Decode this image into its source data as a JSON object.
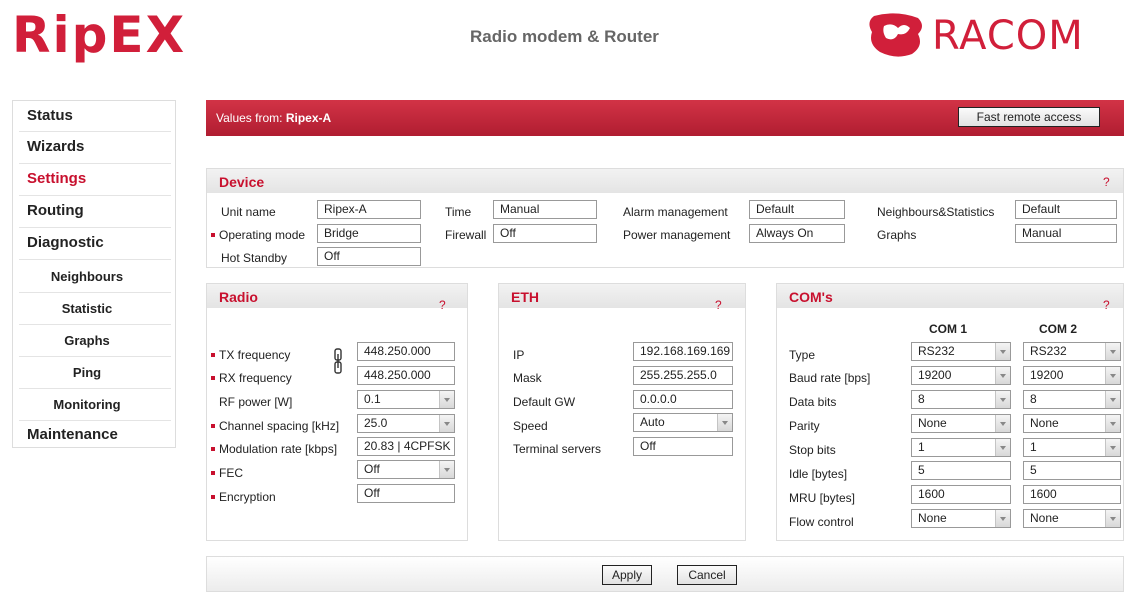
{
  "header": {
    "logo": "RipEX",
    "subtitle": "Radio modem & Router",
    "brand": "RACOM"
  },
  "nav": {
    "items": [
      "Status",
      "Wizards",
      "Settings",
      "Routing",
      "Diagnostic"
    ],
    "sub_items": [
      "Neighbours",
      "Statistic",
      "Graphs",
      "Ping",
      "Monitoring"
    ],
    "last": "Maintenance",
    "active": "Settings"
  },
  "topbar": {
    "label": "Values from:",
    "unit": "Ripex-A",
    "button": "Fast remote access"
  },
  "device": {
    "title": "Device",
    "help": "?",
    "unit_name_label": "Unit name",
    "unit_name": "Ripex-A",
    "operating_mode_label": "Operating mode",
    "operating_mode": "Bridge",
    "hot_standby_label": "Hot Standby",
    "hot_standby": "Off",
    "time_label": "Time",
    "time": "Manual",
    "firewall_label": "Firewall",
    "firewall": "Off",
    "alarm_label": "Alarm management",
    "alarm": "Default",
    "power_label": "Power management",
    "power": "Always On",
    "neighbours_label": "Neighbours&Statistics",
    "neighbours": "Default",
    "graphs_label": "Graphs",
    "graphs": "Manual"
  },
  "radio": {
    "title": "Radio",
    "help": "?",
    "tx_label": "TX frequency",
    "tx": "448.250.000",
    "rx_label": "RX frequency",
    "rx": "448.250.000",
    "rf_label": "RF power [W]",
    "rf": "0.1",
    "ch_label": "Channel spacing [kHz]",
    "ch": "25.0",
    "mod_label": "Modulation rate [kbps]",
    "mod": "20.83 | 4CPFSK",
    "fec_label": "FEC",
    "fec": "Off",
    "enc_label": "Encryption",
    "enc": "Off"
  },
  "eth": {
    "title": "ETH",
    "help": "?",
    "ip_label": "IP",
    "ip": "192.168.169.169",
    "mask_label": "Mask",
    "mask": "255.255.255.0",
    "gw_label": "Default GW",
    "gw": "0.0.0.0",
    "speed_label": "Speed",
    "speed": "Auto",
    "ts_label": "Terminal servers",
    "ts": "Off"
  },
  "coms": {
    "title": "COM's",
    "help": "?",
    "col1": "COM 1",
    "col2": "COM 2",
    "type_label": "Type",
    "type1": "RS232",
    "type2": "RS232",
    "baud_label": "Baud rate [bps]",
    "baud1": "19200",
    "baud2": "19200",
    "data_label": "Data bits",
    "data1": "8",
    "data2": "8",
    "parity_label": "Parity",
    "parity1": "None",
    "parity2": "None",
    "stop_label": "Stop bits",
    "stop1": "1",
    "stop2": "1",
    "idle_label": "Idle [bytes]",
    "idle1": "5",
    "idle2": "5",
    "mru_label": "MRU [bytes]",
    "mru1": "1600",
    "mru2": "1600",
    "flow_label": "Flow control",
    "flow1": "None",
    "flow2": "None"
  },
  "actions": {
    "apply": "Apply",
    "cancel": "Cancel"
  },
  "colors": {
    "accent": "#c8102e",
    "topbar": "#c4263b"
  }
}
